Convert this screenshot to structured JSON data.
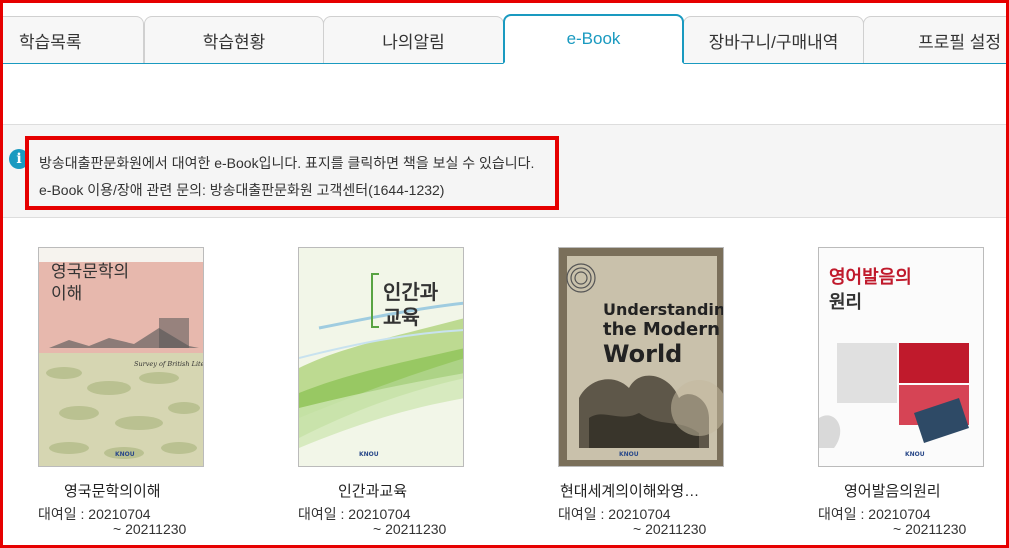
{
  "tabs": [
    {
      "label": "학습목록",
      "active": false
    },
    {
      "label": "학습현황",
      "active": false
    },
    {
      "label": "나의알림",
      "active": false
    },
    {
      "label": "e-Book",
      "active": true
    },
    {
      "label": "장바구니/구매내역",
      "active": false
    },
    {
      "label": "프로필 설정",
      "active": false
    }
  ],
  "notice": {
    "line1": "방송대출판문화원에서 대여한 e-Book입니다. 표지를 클릭하면 책을 보실 수 있습니다.",
    "line2": "e-Book 이용/장애 관련 문의: 방송대출판문화원 고객센터(1644-1232)",
    "icon": "info-icon",
    "icon_glyph": "i"
  },
  "colors": {
    "accent": "#1a9ac0",
    "highlight": "#e60000"
  },
  "books": [
    {
      "title": "영국문학의이해",
      "rental_label": "대여일 : 20210704",
      "rental_end": "~ 20211230",
      "cover": {
        "title_line1": "영국문학의",
        "title_line2": "이해",
        "subtitle": "Survey of British Literature",
        "publisher": "KNOU"
      }
    },
    {
      "title": "인간과교육",
      "rental_label": "대여일 : 20210704",
      "rental_end": "~ 20211230",
      "cover": {
        "title_line1": "인간과",
        "title_line2": "교육",
        "publisher": "KNOU"
      }
    },
    {
      "title": "현대세계의이해와영…",
      "rental_label": "대여일 : 20210704",
      "rental_end": "~ 20211230",
      "cover": {
        "title_line1": "Understanding",
        "title_line2": "the Modern",
        "title_line3": "World",
        "publisher": "KNOU"
      }
    },
    {
      "title": "영어발음의원리",
      "rental_label": "대여일 : 20210704",
      "rental_end": "~ 20211230",
      "cover": {
        "title_line1": "영어발음의",
        "title_line2": "원리",
        "publisher": "KNOU"
      }
    }
  ]
}
